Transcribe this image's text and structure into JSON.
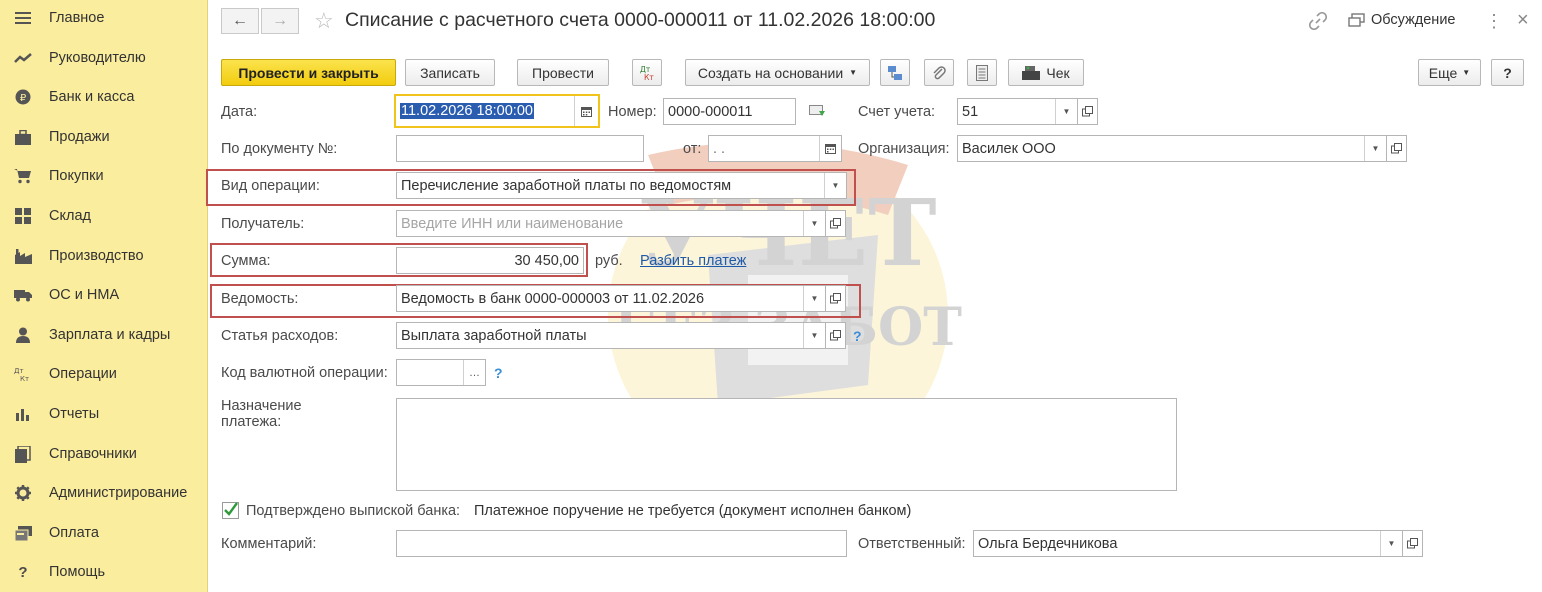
{
  "sidebar": {
    "items": [
      {
        "label": "Главное",
        "icon": "menu-icon"
      },
      {
        "label": "Руководителю",
        "icon": "trend-icon"
      },
      {
        "label": "Банк и касса",
        "icon": "ruble-coin-icon"
      },
      {
        "label": "Продажи",
        "icon": "briefcase-icon"
      },
      {
        "label": "Покупки",
        "icon": "cart-icon"
      },
      {
        "label": "Склад",
        "icon": "warehouse-icon"
      },
      {
        "label": "Производство",
        "icon": "factory-icon"
      },
      {
        "label": "ОС и НМА",
        "icon": "truck-icon"
      },
      {
        "label": "Зарплата и кадры",
        "icon": "person-icon"
      },
      {
        "label": "Операции",
        "icon": "dt-kt-icon"
      },
      {
        "label": "Отчеты",
        "icon": "bar-chart-icon"
      },
      {
        "label": "Справочники",
        "icon": "books-icon"
      },
      {
        "label": "Администрирование",
        "icon": "gear-icon"
      },
      {
        "label": "Оплата",
        "icon": "payment-icon"
      },
      {
        "label": "Помощь",
        "icon": "question-icon"
      }
    ]
  },
  "header": {
    "title": "Списание с расчетного счета 0000-000011 от 11.02.2026 18:00:00",
    "discussion_label": "Обсуждение"
  },
  "toolbar": {
    "post_close": "Провести и закрыть",
    "save": "Записать",
    "post": "Провести",
    "dtkt": "Дт Кт",
    "create_based": "Создать на основании",
    "check": "Чек",
    "more": "Еще",
    "help": "?"
  },
  "form": {
    "date_label": "Дата:",
    "date_value": "11.02.2026 18:00:00",
    "number_label": "Номер:",
    "number_value": "0000-000011",
    "account_label": "Счет учета:",
    "account_value": "51",
    "doc_no_label": "По документу №:",
    "doc_no_value": "",
    "from_label": "от:",
    "from_value": " .  .",
    "org_label": "Организация:",
    "org_value": "Василек ООО",
    "op_type_label": "Вид операции:",
    "op_type_value": "Перечисление заработной платы по ведомостям",
    "recipient_label": "Получатель:",
    "recipient_placeholder": "Введите ИНН или наименование",
    "sum_label": "Сумма:",
    "sum_value": "30 450,00",
    "currency": "руб.",
    "split_link": "Разбить платеж",
    "statement_label": "Ведомость:",
    "statement_value": "Ведомость в банк 0000-000003 от 11.02.2026",
    "expense_label": "Статья расходов:",
    "expense_value": "Выплата заработной платы",
    "currency_code_label": "Код валютной операции:",
    "currency_code_value": "",
    "purpose_label_1": "Назначение",
    "purpose_label_2": "платежа:",
    "purpose_value": "",
    "confirmed_label": "Подтверждено выпиской банка:",
    "confirmed_checked": true,
    "payment_order_note": "Платежное поручение не требуется (документ исполнен банком)",
    "comment_label": "Комментарий:",
    "comment_value": "",
    "responsible_label": "Ответственный:",
    "responsible_value": "Ольга Бердечникова"
  },
  "watermark": {
    "line1": "УЧЕТ",
    "line2": "БЕЗ ЗАБОТ"
  },
  "colors": {
    "sidebar_bg": "#fbed9e",
    "primary_button": "#f5d11b",
    "highlight_border": "#c0504d",
    "link": "#1f5aa6"
  }
}
